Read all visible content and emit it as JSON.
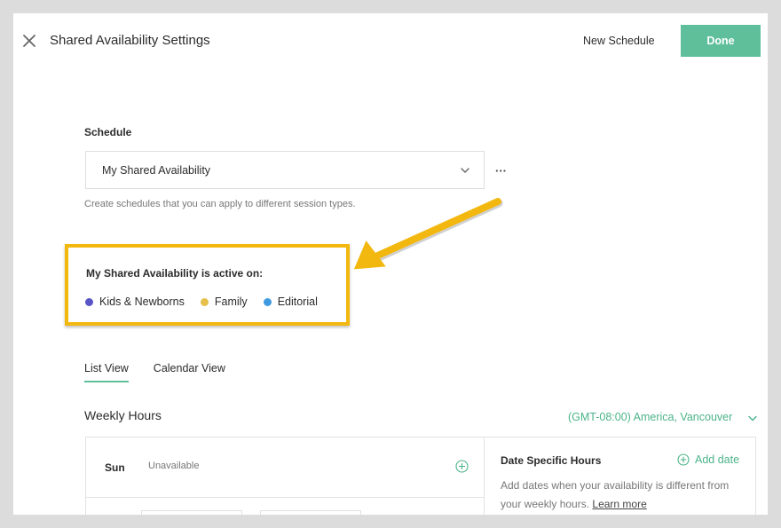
{
  "header": {
    "title": "Shared Availability Settings",
    "new_schedule_label": "New Schedule",
    "done_label": "Done"
  },
  "schedule": {
    "label": "Schedule",
    "selected": "My Shared Availability",
    "more_label": "···",
    "help_text": "Create schedules that you can apply to different session types."
  },
  "active_on": {
    "title": "My Shared Availability is active on:",
    "tags": [
      {
        "label": "Kids & Newborns",
        "color": "#5a55c6"
      },
      {
        "label": "Family",
        "color": "#e6c04a"
      },
      {
        "label": "Editorial",
        "color": "#3f9be0"
      }
    ]
  },
  "tabs": {
    "items": [
      "List View",
      "Calendar View"
    ],
    "active": "List View"
  },
  "weekly": {
    "title": "Weekly Hours",
    "timezone": "(GMT-08:00) America, Vancouver",
    "rows": [
      {
        "day": "Sun",
        "status": "Unavailable"
      }
    ]
  },
  "date_specific": {
    "title": "Date Specific Hours",
    "add_label": "Add date",
    "desc": "Add dates when your availability is different from your weekly hours.",
    "learn_more": "Learn more"
  },
  "colors": {
    "accent": "#5fbf9a",
    "highlight": "#f2b80f"
  }
}
